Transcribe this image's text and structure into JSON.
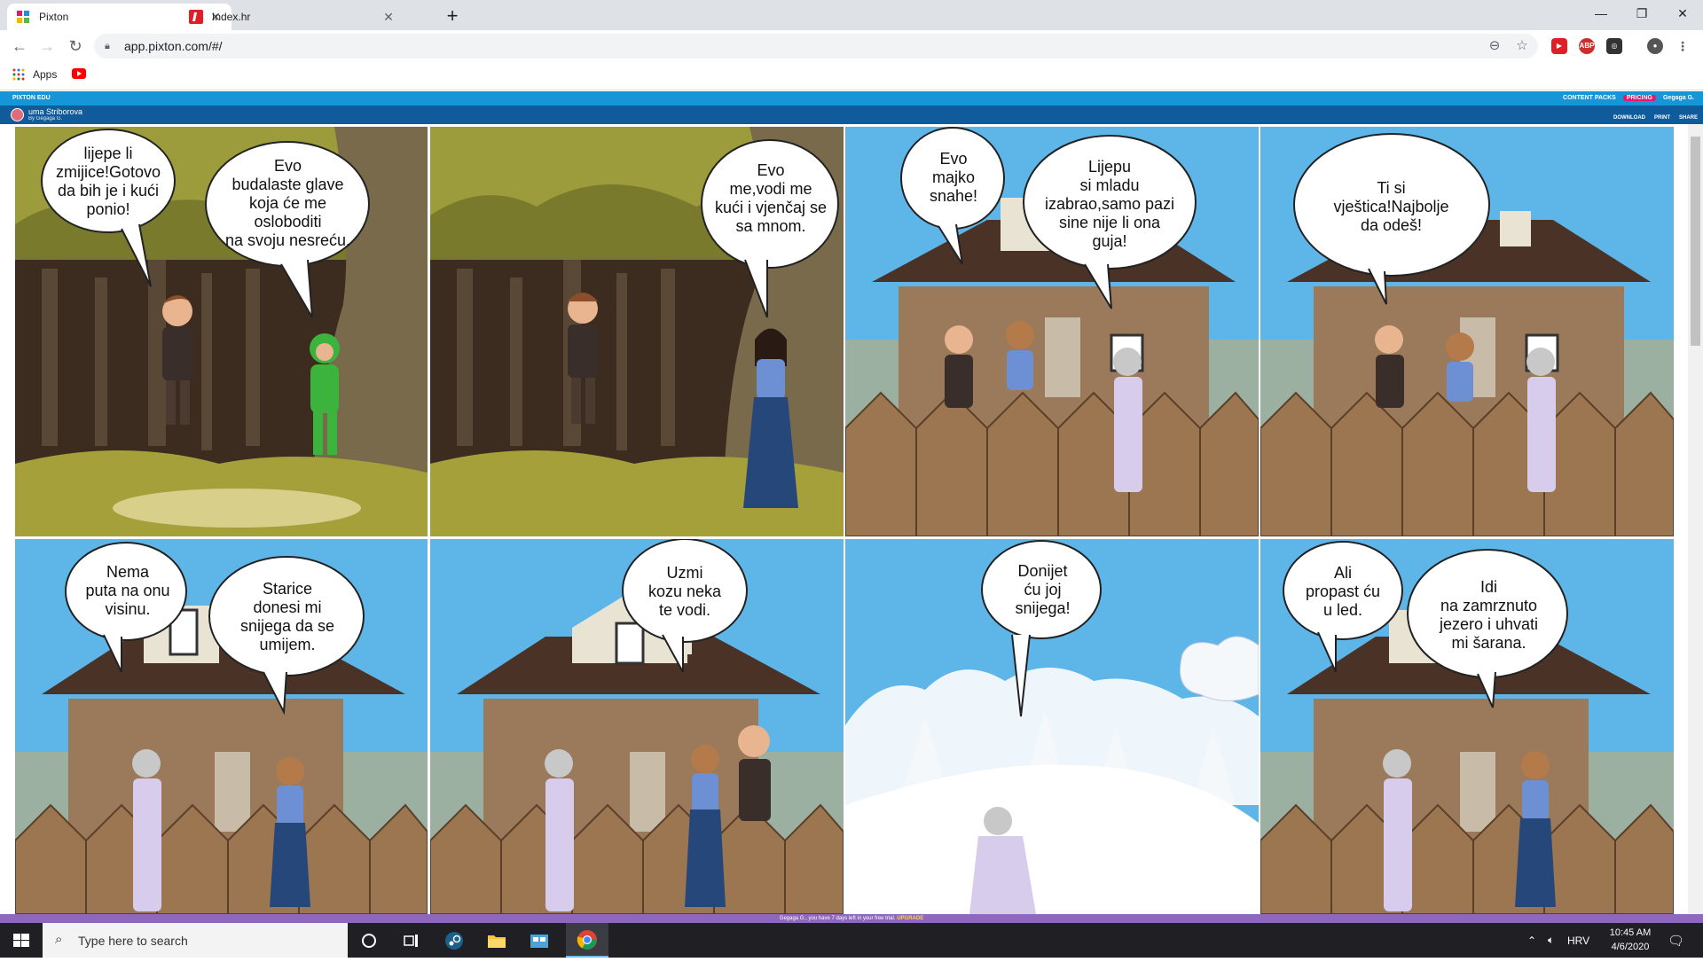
{
  "browser": {
    "tabs": [
      {
        "title": "Pixton",
        "active": true,
        "favicon": "pixton-icon"
      },
      {
        "title": "Index.hr",
        "active": false,
        "favicon": "index-hr-icon"
      }
    ],
    "url": "app.pixton.com/#/",
    "bookmarks": {
      "apps_label": "Apps"
    }
  },
  "pixton": {
    "brand": "PIXTON EDU",
    "top_links": [
      "CONTENT PACKS",
      "PRICING",
      "Gegaga G."
    ],
    "comic_title": "uma Striborova",
    "comic_author": "By Gegaga G.",
    "actions": [
      "DOWNLOAD",
      "PRINT",
      "SHARE"
    ],
    "trial_text": "Gegaga G., you have 7 days left in your free trial.",
    "trial_link": "UPGRADE"
  },
  "panels": [
    {
      "scene": "forest",
      "bubbles": [
        "lijepe li\nzmijice!Gotovo\nda bih je i kući\nponio!",
        "Evo\nbudalaste glave\nkoja će me osloboditi\nna svoju nesreću."
      ]
    },
    {
      "scene": "forest2",
      "bubbles": [
        "Evo\nme,vodi me\nkući i vjenčaj se\nsa mnom."
      ]
    },
    {
      "scene": "house",
      "bubbles": [
        "Evo\nmajko\nsnahe!",
        "Lijepu\nsi mladu\nizabrao,samo pazi\nsine nije li ona\nguja!"
      ]
    },
    {
      "scene": "house",
      "bubbles": [
        "Ti si\nvještica!Najbolje\nda odeš!"
      ]
    },
    {
      "scene": "house",
      "bubbles": [
        "Nema\nputa na onu\nvisinu.",
        "Starice\ndonesi mi\nsnijega da se\numijem."
      ]
    },
    {
      "scene": "house",
      "bubbles": [
        "Uzmi\nkozu neka\nte vodi."
      ]
    },
    {
      "scene": "snow",
      "bubbles": [
        "Donijet\nću joj\nsnijega!"
      ]
    },
    {
      "scene": "house",
      "bubbles": [
        "Ali\npropast ću\nu led.",
        "Idi\nna zamrznuto\njezero i uhvati\nmi šarana."
      ]
    }
  ],
  "taskbar": {
    "search_placeholder": "Type here to search",
    "language": "HRV",
    "time": "10:45 AM",
    "date": "4/6/2020"
  },
  "colors": {
    "pixton_blue": "#1596d9",
    "pixton_dark": "#0f5b9c",
    "trial_purple": "#8f67bd",
    "sky": "#5eb5e8",
    "forest": "#7a7a2c"
  }
}
